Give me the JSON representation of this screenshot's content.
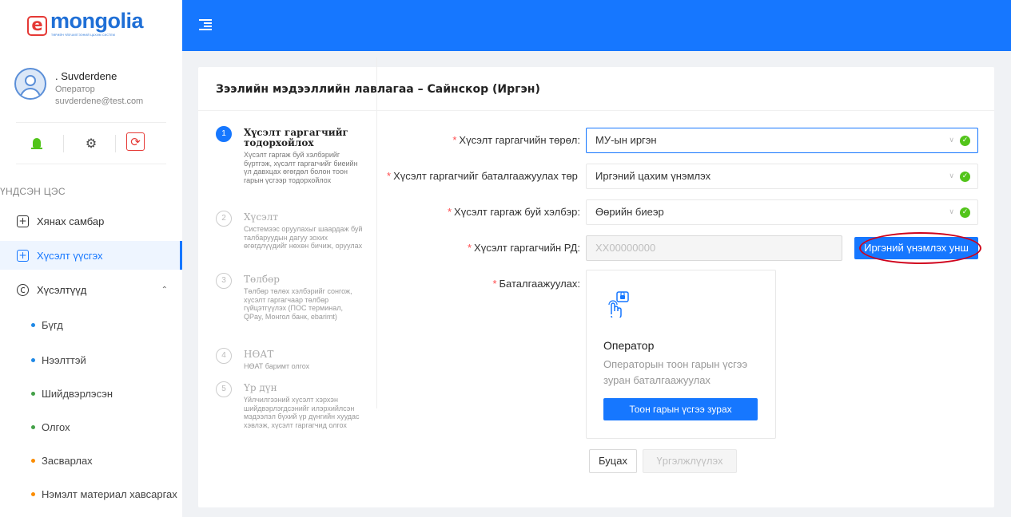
{
  "logo": {
    "mark": "e",
    "text": "mongolia",
    "subtitle": "ТӨРИЙН ҮЙЛЧИЛГЭЭНИЙ ЦАХИМ СИСТЕМ"
  },
  "user": {
    "name": ". Suvderdene",
    "role": "Оператор",
    "email": "suvderdene@test.com"
  },
  "sidebar": {
    "section_title": "ҮНДСЭН ЦЭС",
    "menu": [
      {
        "label": "Хянах самбар",
        "icon": "plus-square-icon"
      },
      {
        "label": "Хүсэлт үүсгэх",
        "icon": "plus-square-icon",
        "active": true
      },
      {
        "label": "Хүсэлтүүд",
        "icon": "copyright-icon",
        "expanded": true
      }
    ],
    "submenu": [
      {
        "label": "Бүгд",
        "color": "#1e88e5"
      },
      {
        "label": "Нээлттэй",
        "color": "#1e88e5"
      },
      {
        "label": "Шийдвэрлэсэн",
        "color": "#43a047"
      },
      {
        "label": "Олгох",
        "color": "#43a047"
      },
      {
        "label": "Засварлах",
        "color": "#fb8c00"
      },
      {
        "label": "Нэмэлт материал хавсаргах",
        "color": "#fb8c00"
      }
    ]
  },
  "header": {
    "color": "#1677ff"
  },
  "page": {
    "title": "Зээлийн мэдээллийн лавлагаа – Сайнскор (Иргэн)"
  },
  "steps": [
    {
      "num": "1",
      "title": "Хүсэлт гаргагчийг тодорхойлох",
      "desc": "Хүсэлт гаргаж буй хэлбэрийг бүртгэж, хүсэлт гаргагчийг биеийн үл давхцах өгөгдөл болон тоон гарын үсгээр тодорхойлох",
      "active": true
    },
    {
      "num": "2",
      "title": "Хүсэлт",
      "desc": "Системээс оруулахыг шаардаж буй талбаруудын дагуу зохих өгөгдлүүдийг нөхөн бичиж, оруулах"
    },
    {
      "num": "3",
      "title": "Төлбөр",
      "desc": "Төлбөр төлөх хэлбэрийг сонгож, хүсэлт гаргагчаар төлбөр гүйцэтгүүлэх (ПОС терминал, QPay, Монгол банк, ebarimt)"
    },
    {
      "num": "4",
      "title": "НӨАТ",
      "desc": "НӨАТ баримт олгох"
    },
    {
      "num": "5",
      "title": "Үр дүн",
      "desc": "Үйлчилгээний хүсэлт хэрхэн шийдвэрлэгдсэнийг илэрхийлсэн мэдээлэл бүхий үр дүнгийн хуудас хэвлэж, хүсэлт гаргагчид олгох"
    }
  ],
  "form": {
    "applicant_type": {
      "label": "Хүсэлт гаргагчийн төрөл:",
      "value": "МУ-ын иргэн"
    },
    "verification": {
      "label": "Хүсэлт гаргагчийг баталгаажуулах төр",
      "value": "Иргэний цахим үнэмлэх"
    },
    "submission_form": {
      "label": "Хүсэлт гаргаж буй хэлбэр:",
      "value": "Өөрийн биеэр"
    },
    "register": {
      "label": "Хүсэлт гаргагчийн РД:",
      "placeholder": "XX00000000",
      "button": "Иргэний үнэмлэх унш"
    },
    "confirm": {
      "label": "Баталгаажуулах:"
    }
  },
  "operator_card": {
    "title": "Оператор",
    "desc": "Операторын тоон гарын үсгээ зуран баталгаажуулах",
    "button": "Тоон гарын үсгээ зурах"
  },
  "footer_buttons": {
    "back": "Буцах",
    "next": "Үргэлжлүүлэх"
  }
}
